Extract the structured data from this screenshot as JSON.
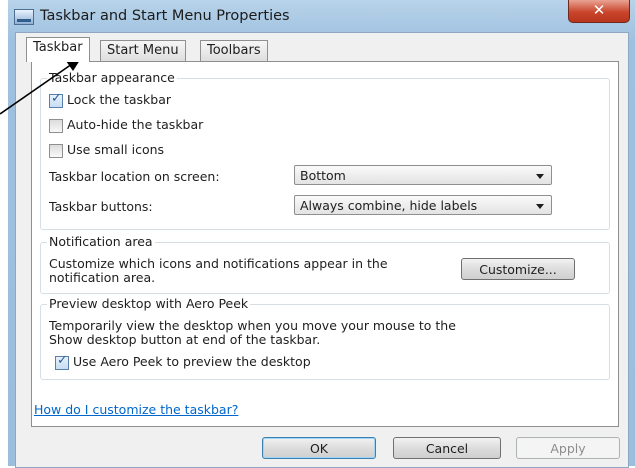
{
  "window": {
    "title": "Taskbar and Start Menu Properties",
    "close_glyph": "✕"
  },
  "tabs": [
    {
      "label": "Taskbar",
      "active": true
    },
    {
      "label": "Start Menu",
      "active": false
    },
    {
      "label": "Toolbars",
      "active": false
    }
  ],
  "appearance": {
    "legend": "Taskbar appearance",
    "lock_label": "Lock the taskbar",
    "lock_checked": true,
    "autohide_label": "Auto-hide the taskbar",
    "autohide_checked": false,
    "small_icons_label": "Use small icons",
    "small_icons_checked": false,
    "location_label": "Taskbar location on screen:",
    "location_value": "Bottom",
    "buttons_label": "Taskbar buttons:",
    "buttons_value": "Always combine, hide labels"
  },
  "notification": {
    "legend": "Notification area",
    "description_line1": "Customize which icons and notifications appear in the",
    "description_line2": "notification area.",
    "customize_label": "Customize..."
  },
  "aero_peek": {
    "legend": "Preview desktop with Aero Peek",
    "description_line1": "Temporarily view the desktop when you move your mouse to the",
    "description_line2": "Show desktop button at end of the taskbar.",
    "use_label": "Use Aero Peek to preview the desktop",
    "use_checked": true
  },
  "help_link": "How do I customize the taskbar?",
  "buttons": {
    "ok": "OK",
    "cancel": "Cancel",
    "apply": "Apply"
  },
  "colors": {
    "link": "#0066cc",
    "title_bar": "#b8d3ea",
    "close_button": "#c9452b"
  }
}
